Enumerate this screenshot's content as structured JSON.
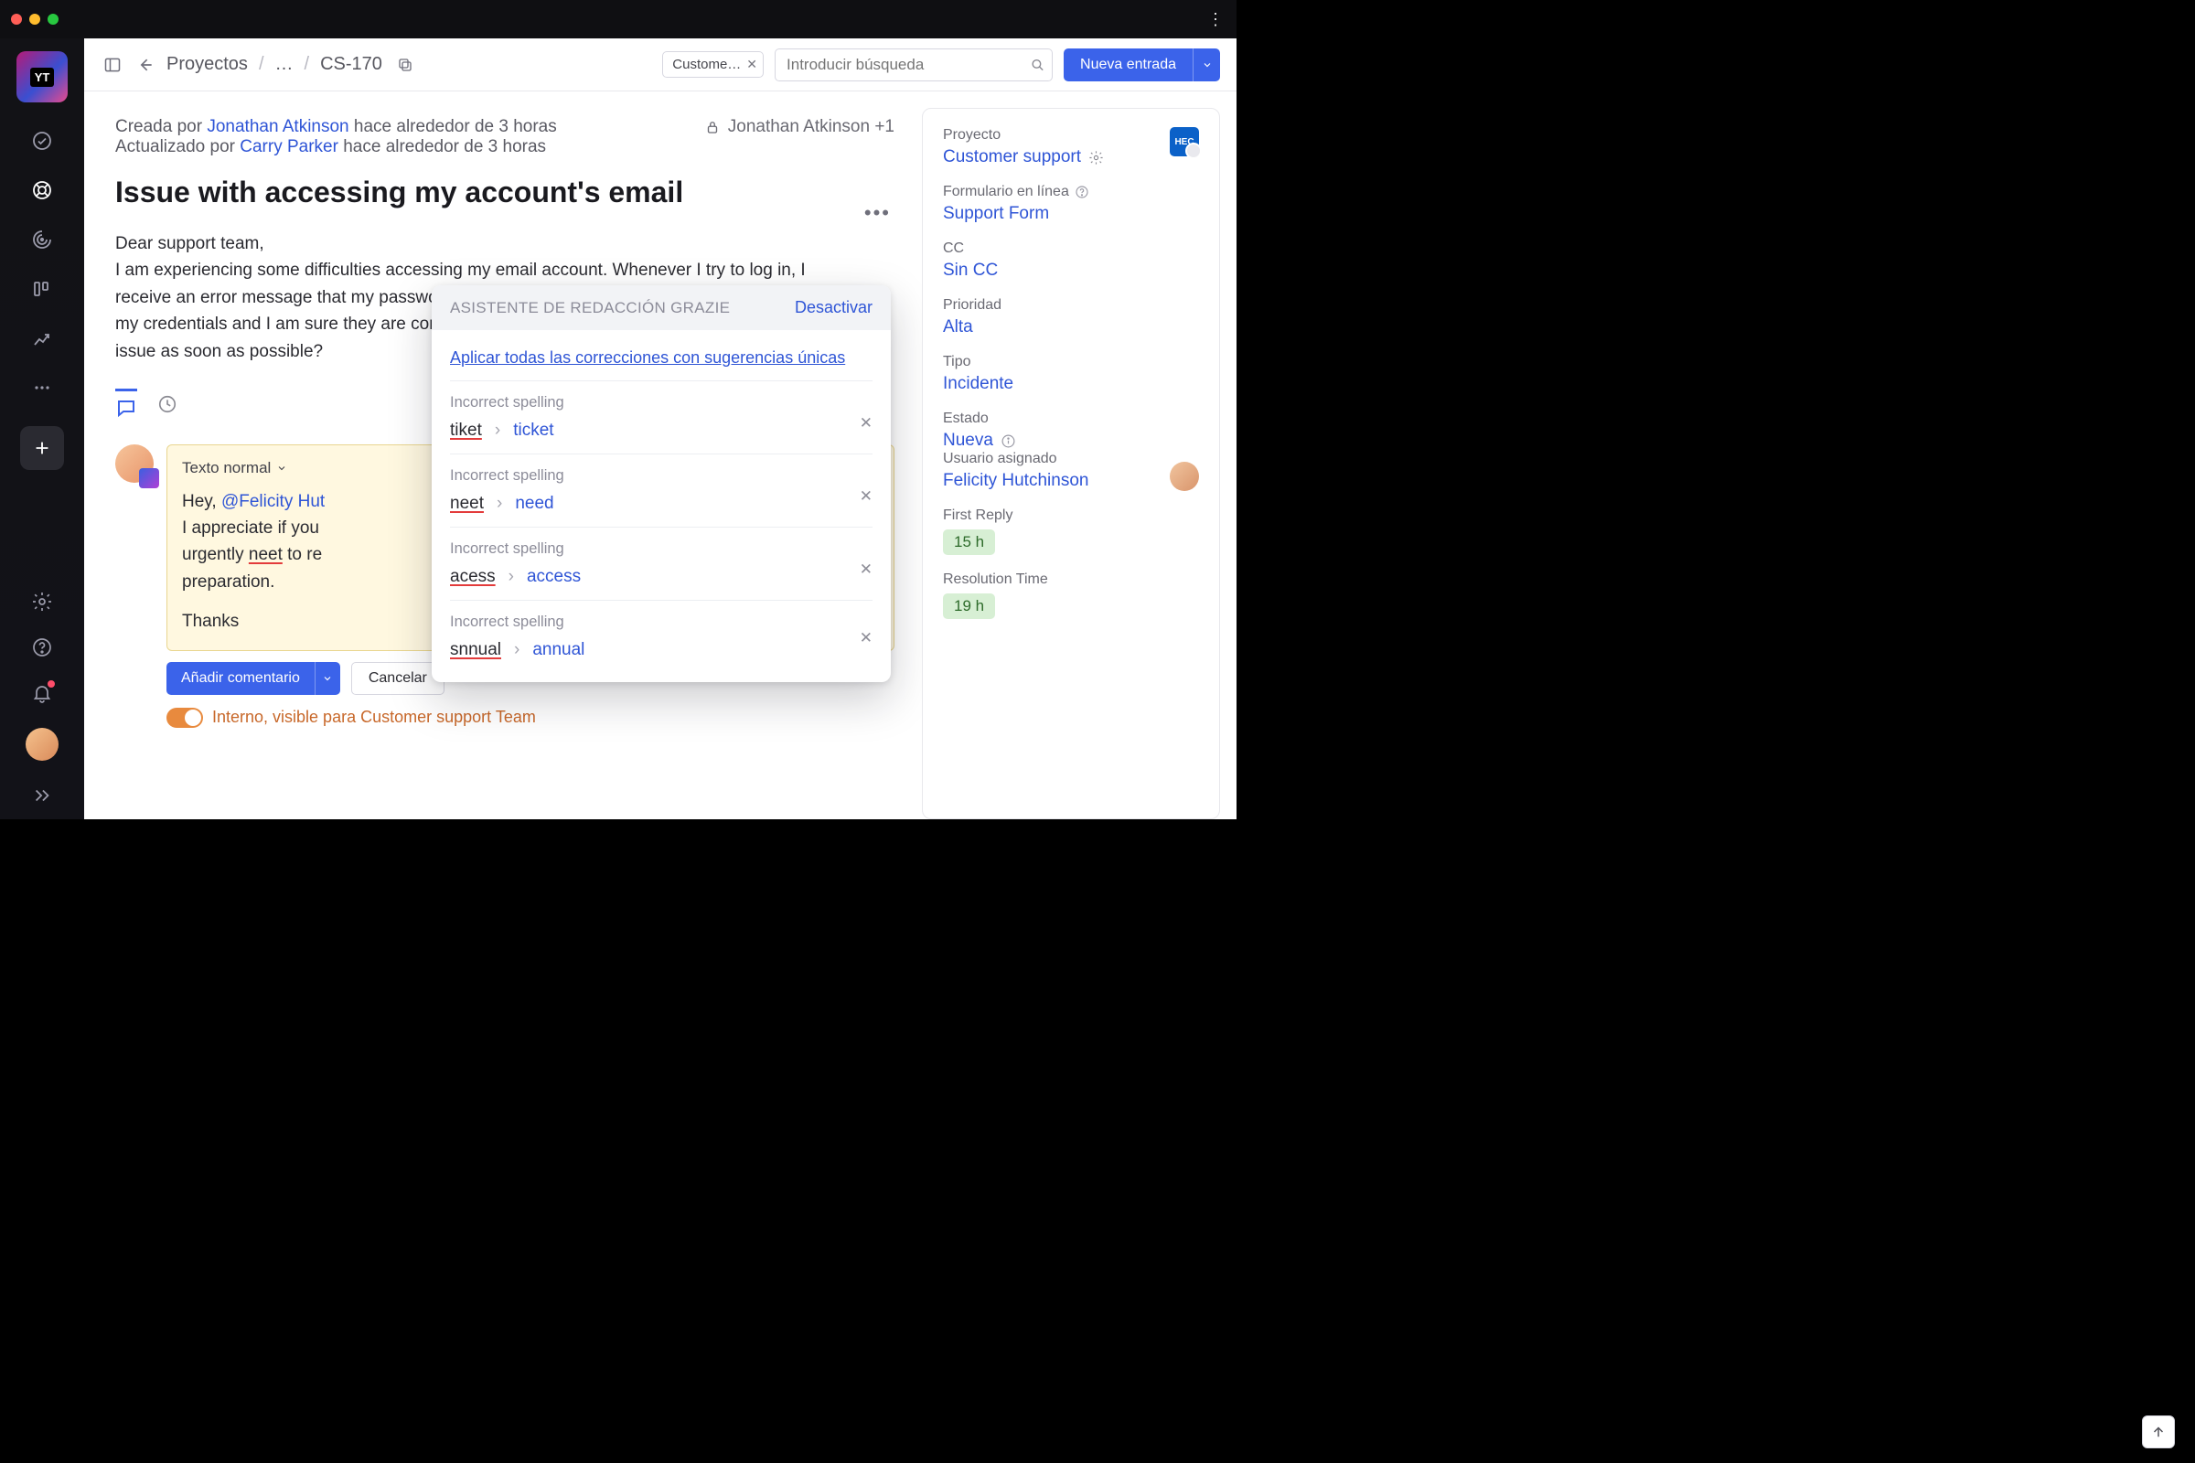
{
  "titlebar": {
    "ellipsis": "⋮"
  },
  "sidebar": {
    "logo": "YT"
  },
  "breadcrumb": {
    "projects": "Proyectos",
    "dots": "…",
    "issue": "CS-170"
  },
  "search": {
    "chip": "Custome…",
    "placeholder": "Introducir búsqueda"
  },
  "new_btn": "Nueva entrada",
  "issue": {
    "created_prefix": "Creada por ",
    "creator": "Jonathan Atkinson",
    "created_suffix": " hace alrededor de 3 horas",
    "updated_prefix": "Actualizado por ",
    "updater": "Carry Parker",
    "updated_suffix": " hace alrededor de 3 horas",
    "visible_to": "Jonathan Atkinson +1",
    "title": "Issue with accessing my account's email",
    "body_l1": "Dear support team,",
    "body_l2": "I am experiencing some difficulties accessing my email account. Whenever I try to log in, I receive an error message that my password is incorrect. However, I have double-checked my credentials and I am sure they are correct. Could you please help me resolving this issue as soon as possible?"
  },
  "editor": {
    "format": "Texto normal",
    "l1_a": "Hey, ",
    "mention": "@Felicity Hut",
    "l2_a": "I appreciate if you ",
    "l3_a": "urgently ",
    "l3_miss": "neet",
    "l3_b": " to re",
    "l4": "preparation.",
    "l5": "Thanks",
    "err_count": "4"
  },
  "buttons": {
    "add": "Añadir comentario",
    "cancel": "Cancelar"
  },
  "toggle_label": "Interno, visible para Customer support Team",
  "popup": {
    "title": "ASISTENTE DE REDACCIÓN GRAZIE",
    "disable": "Desactivar",
    "apply_all": "Aplicar todas las correcciones con sugerencias únicas",
    "label": "Incorrect spelling",
    "suggestions": [
      {
        "wrong": "tiket",
        "right": "ticket"
      },
      {
        "wrong": "neet",
        "right": "need"
      },
      {
        "wrong": "acess",
        "right": "access"
      },
      {
        "wrong": "snnual",
        "right": "annual"
      }
    ]
  },
  "panel": {
    "project_label": "Proyecto",
    "project_value": "Customer support",
    "project_icon": "HEC",
    "form_label": "Formulario en línea",
    "form_value": "Support Form",
    "cc_label": "CC",
    "cc_value": "Sin CC",
    "prio_label": "Prioridad",
    "prio_value": "Alta",
    "type_label": "Tipo",
    "type_value": "Incidente",
    "state_label": "Estado",
    "state_value": "Nueva",
    "assignee_label": "Usuario asignado",
    "assignee_value": "Felicity Hutchinson",
    "first_reply_label": "First Reply",
    "first_reply_value": "15 h",
    "resolution_label": "Resolution Time",
    "resolution_value": "19 h"
  }
}
